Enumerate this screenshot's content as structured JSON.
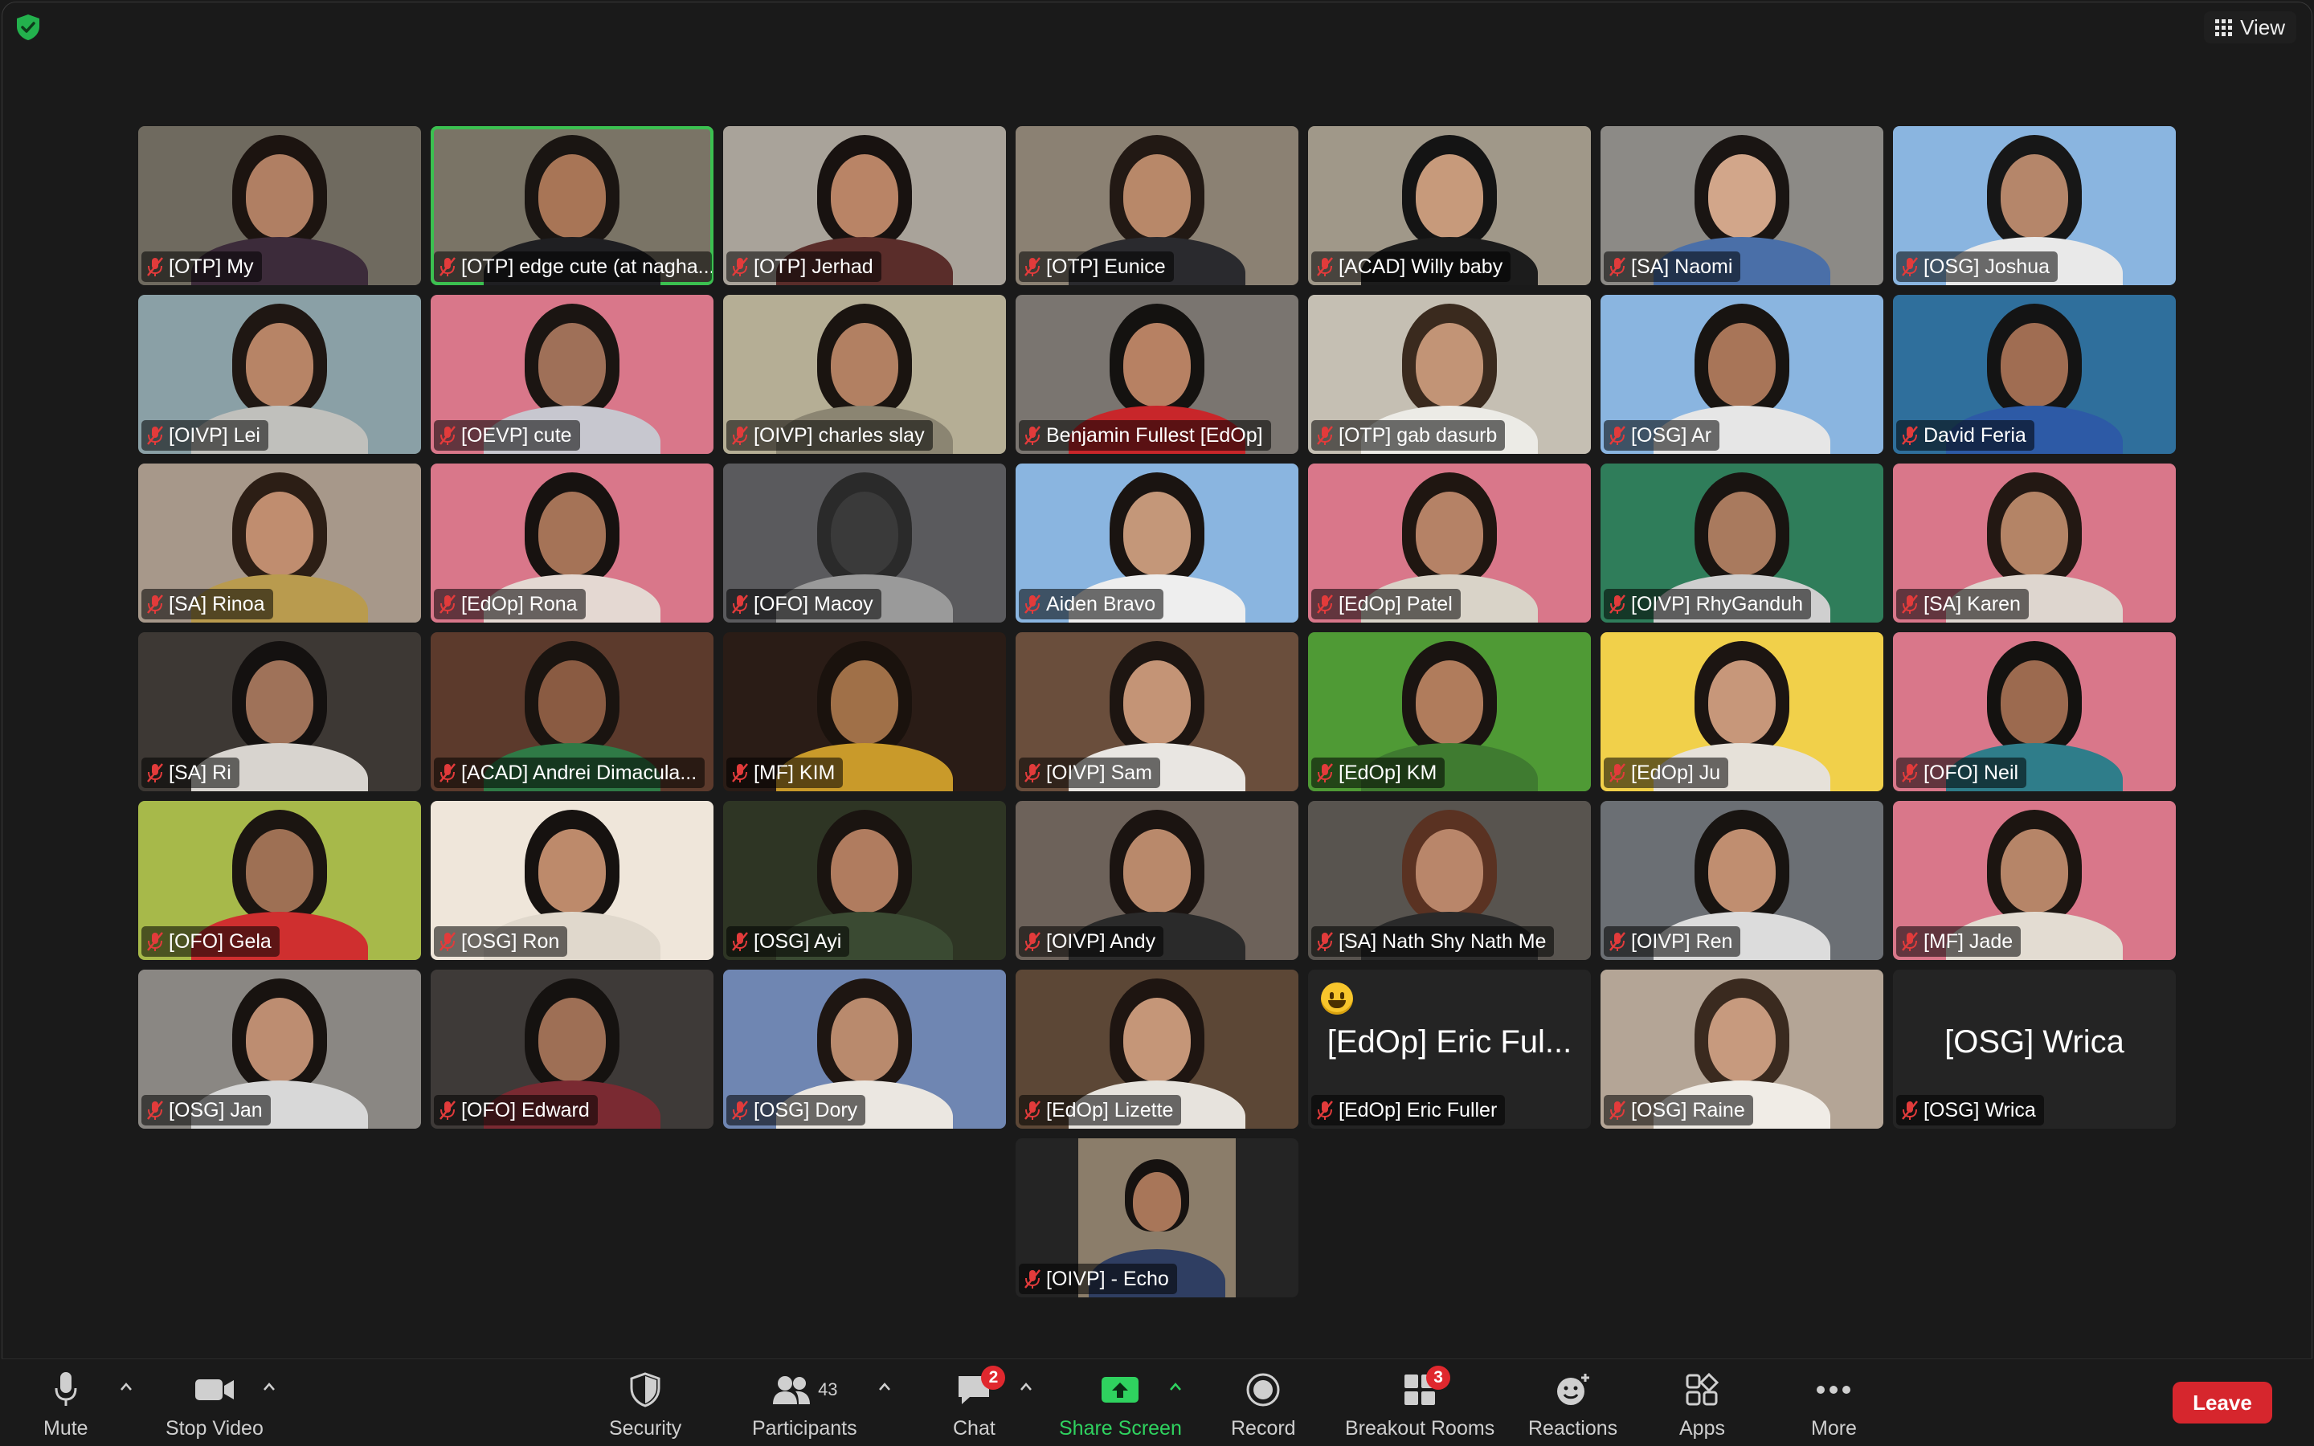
{
  "top": {
    "view_label": "View"
  },
  "participants": [
    [
      {
        "name": "[OTP] My",
        "bg": "#6f6a5f",
        "skin": "#b07f63",
        "hair": "#1c1410",
        "shirt": "#3c2b3a"
      },
      {
        "name": "[OTP] edge cute (at nagha...",
        "bg": "#7a7466",
        "skin": "#a87556",
        "hair": "#1a1512",
        "shirt": "#1f1f22",
        "active": true
      },
      {
        "name": "[OTP] Jerhad",
        "bg": "#a9a39a",
        "skin": "#b98466",
        "hair": "#181210",
        "shirt": "#5a2d2a"
      },
      {
        "name": "[OTP] Eunice",
        "bg": "#8b8173",
        "skin": "#b88869",
        "hair": "#221914",
        "shirt": "#2a2a2e"
      },
      {
        "name": "[ACAD] Willy baby",
        "bg": "#a09889",
        "skin": "#c79a7b",
        "hair": "#141414",
        "shirt": "#1c1c1c"
      },
      {
        "name": "[SA] Naomi",
        "bg": "#8c8a86",
        "skin": "#d2a68a",
        "hair": "#1a1513",
        "shirt": "#4a6fa8"
      },
      {
        "name": "[OSG] Joshua",
        "bg": "#8ab5e0",
        "skin": "#b5866a",
        "hair": "#171717",
        "shirt": "#e9e9e9"
      }
    ],
    [
      {
        "name": "[OIVP] Lei",
        "bg": "#8aa0a6",
        "skin": "#b78466",
        "hair": "#1f1713",
        "shirt": "#c0c0bc"
      },
      {
        "name": "[OEVP] cute",
        "bg": "#d9778a",
        "skin": "#9f7058",
        "hair": "#1b1512",
        "shirt": "#c7c7cf"
      },
      {
        "name": "[OIVP] charles slay",
        "bg": "#b5ae95",
        "skin": "#b28062",
        "hair": "#1a1410",
        "shirt": "#8b8572"
      },
      {
        "name": "Benjamin Fullest [EdOp]",
        "bg": "#7a7570",
        "skin": "#b78163",
        "hair": "#141210",
        "shirt": "#c8262a"
      },
      {
        "name": "[OTP] gab dasurb",
        "bg": "#c5bfb3",
        "skin": "#c29476",
        "hair": "#3a2a1e",
        "shirt": "#ecebe6"
      },
      {
        "name": "[OSG] Ar",
        "bg": "#8ab5e0",
        "skin": "#a87558",
        "hair": "#181411",
        "shirt": "#e6e6e6"
      },
      {
        "name": "David Feria",
        "bg": "#2f6f9c",
        "skin": "#a06d52",
        "hair": "#141414",
        "shirt": "#2d5aa6"
      }
    ],
    [
      {
        "name": "[SA] Rinoa",
        "bg": "#a7988a",
        "skin": "#c08d6f",
        "hair": "#2c1e15",
        "shirt": "#b99b4e"
      },
      {
        "name": "[EdOp] Rona",
        "bg": "#d9778a",
        "skin": "#a57357",
        "hair": "#171210",
        "shirt": "#e4d8d2"
      },
      {
        "name": "[OFO] Macoy",
        "bg": "#5a5a5d",
        "skin": "#3a3a3a",
        "hair": "#2a2a2a",
        "shirt": "#9a9a9a"
      },
      {
        "name": "Aiden Bravo",
        "bg": "#8ab5e0",
        "skin": "#c49779",
        "hair": "#1a1411",
        "shirt": "#eeeeee"
      },
      {
        "name": "[EdOp] Patel",
        "bg": "#d9778a",
        "skin": "#b58266",
        "hair": "#1f1611",
        "shirt": "#d9d3c8"
      },
      {
        "name": "[OIVP] RhyGanduh",
        "bg": "#2f7d5a",
        "skin": "#a97a5e",
        "hair": "#191411",
        "shirt": "#cfcfcf"
      },
      {
        "name": "[SA] Karen",
        "bg": "#d9778a",
        "skin": "#b48466",
        "hair": "#231813",
        "shirt": "#ded6cf"
      }
    ],
    [
      {
        "name": "[SA] Ri",
        "bg": "#3d3834",
        "skin": "#9f7259",
        "hair": "#141110",
        "shirt": "#d8d4cf"
      },
      {
        "name": "[ACAD] Andrei Dimacula...",
        "bg": "#5c3a2c",
        "skin": "#8a5b42",
        "hair": "#1a1410",
        "shirt": "#2f7a46"
      },
      {
        "name": "[MF] KIM",
        "bg": "#2a1c16",
        "skin": "#a07048",
        "hair": "#1a120d",
        "shirt": "#c99a2a"
      },
      {
        "name": "[OIVP] Sam",
        "bg": "#6a4e3c",
        "skin": "#c49476",
        "hair": "#1d1511",
        "shirt": "#e9e6e2"
      },
      {
        "name": "[EdOp] KM",
        "bg": "#4f9a35",
        "skin": "#b07c5c",
        "hair": "#1a1411",
        "shirt": "#3f7b30"
      },
      {
        "name": "[EdOp] Ju",
        "bg": "#f1d04a",
        "skin": "#c7977a",
        "hair": "#1c1512",
        "shirt": "#e6e1d9"
      },
      {
        "name": "[OFO] Neil",
        "bg": "#d9778a",
        "skin": "#9c6a4f",
        "hair": "#141210",
        "shirt": "#2f7d8a"
      }
    ],
    [
      {
        "name": "[OFO] Gela",
        "bg": "#a7b94a",
        "skin": "#9e7054",
        "hair": "#1b1511",
        "shirt": "#cf2f2f"
      },
      {
        "name": "[OSG] Ron",
        "bg": "#efe6da",
        "skin": "#bd8a6b",
        "hair": "#161210",
        "shirt": "#e0d8cc"
      },
      {
        "name": "[OSG] Ayi",
        "bg": "#2e3524",
        "skin": "#b07c5f",
        "hair": "#1a1410",
        "shirt": "#3a4a32"
      },
      {
        "name": "[OIVP] Andy",
        "bg": "#6d625a",
        "skin": "#b9896b",
        "hair": "#1b1411",
        "shirt": "#2a2a2a"
      },
      {
        "name": "[SA] Nath Shy Nath Me",
        "bg": "#58544f",
        "skin": "#b9866a",
        "hair": "#5a3222",
        "shirt": "#2a2a2a"
      },
      {
        "name": "[OIVP] Ren",
        "bg": "#6b6f74",
        "skin": "#c08e70",
        "hair": "#181411",
        "shirt": "#dcdcdc"
      },
      {
        "name": "[MF] Jade",
        "bg": "#d9778a",
        "skin": "#b68568",
        "hair": "#1c1511",
        "shirt": "#e3dcd2"
      }
    ],
    [
      {
        "name": "[OSG] Jan",
        "bg": "#8a8783",
        "skin": "#bd8d71",
        "hair": "#181310",
        "shirt": "#d8d8d8"
      },
      {
        "name": "[OFO] Edward",
        "bg": "#3e3a38",
        "skin": "#9e6f55",
        "hair": "#151210",
        "shirt": "#7a2a32"
      },
      {
        "name": "[OSG] Dory",
        "bg": "#6f86b2",
        "skin": "#b98a6d",
        "hair": "#1e1612",
        "shirt": "#ebe7e1"
      },
      {
        "name": "[EdOp] Lizette",
        "bg": "#5c4736",
        "skin": "#c59678",
        "hair": "#1e1511",
        "shirt": "#e7e3dd"
      },
      {
        "name": "[EdOp] Eric Fuller",
        "display": "[EdOp] Eric Ful...",
        "video_off": true,
        "reaction": "smiley-icon"
      },
      {
        "name": "[OSG] Raine",
        "bg": "#b4a596",
        "skin": "#c79a7e",
        "hair": "#3a2a1f",
        "shirt": "#f0ece6"
      },
      {
        "name": "[OSG] Wrica",
        "display": "[OSG] Wrica",
        "video_off": true
      }
    ],
    [
      {
        "name": "[OIVP] - Echo",
        "bg": "#242424",
        "inner": "#8b7d6a",
        "skin": "#a87659",
        "hair": "#161210",
        "shirt": "#2f3e62",
        "portrait": true
      }
    ]
  ],
  "toolbar": {
    "mute": "Mute",
    "stop_video": "Stop Video",
    "security": "Security",
    "participants": "Participants",
    "participants_count": "43",
    "chat": "Chat",
    "chat_badge": "2",
    "share_screen": "Share Screen",
    "record": "Record",
    "breakout_rooms": "Breakout Rooms",
    "breakout_badge": "3",
    "reactions": "Reactions",
    "apps": "Apps",
    "more": "More",
    "leave": "Leave"
  },
  "colors": {
    "accent_green": "#2fd25f",
    "leave_red": "#d6262d",
    "active_speaker": "#3bc050",
    "badge_red": "#e0282e"
  }
}
